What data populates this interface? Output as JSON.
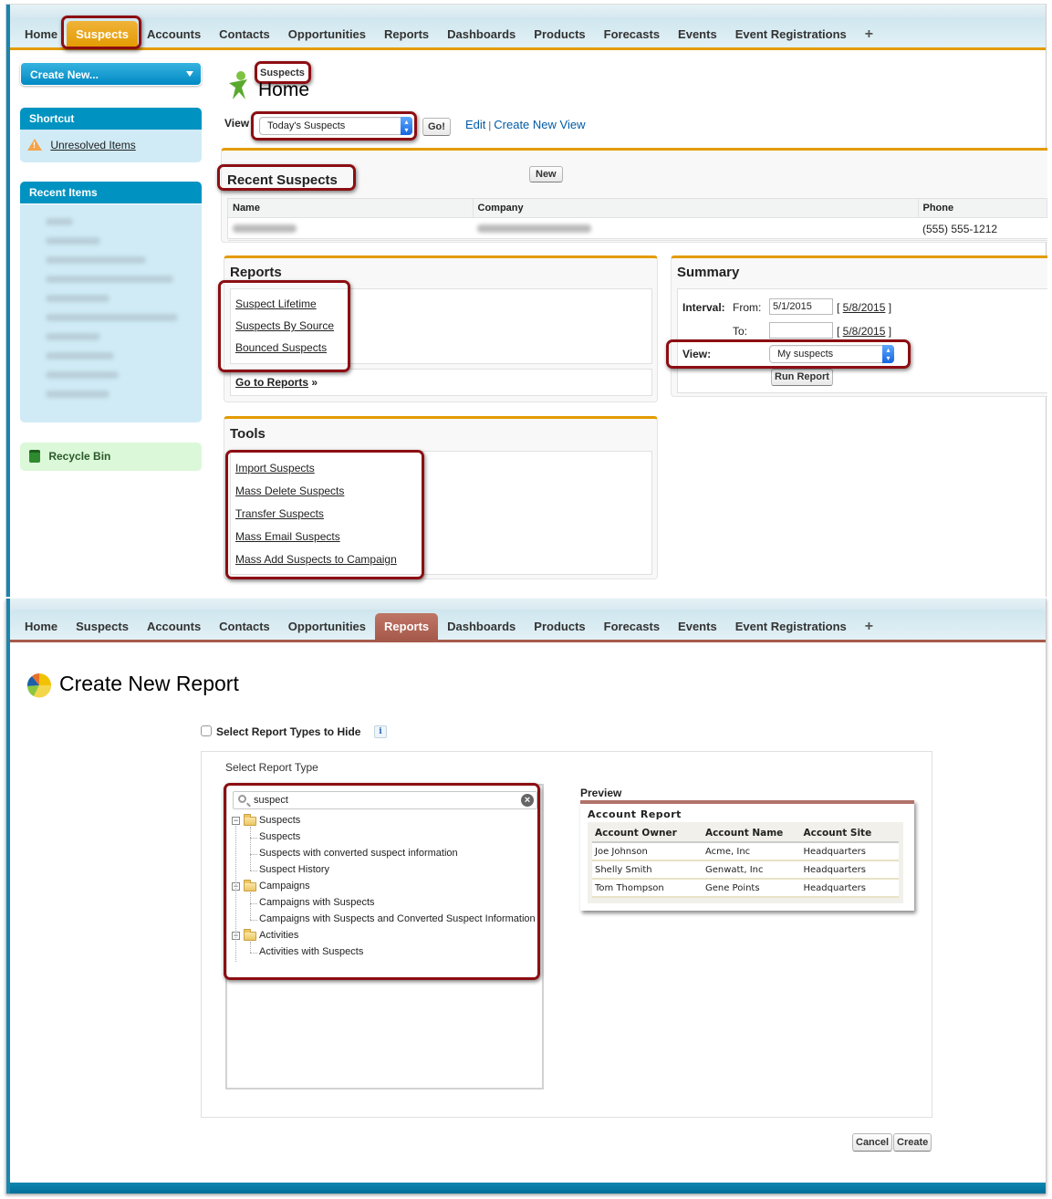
{
  "nav_tabs_top": [
    "Home",
    "Suspects",
    "Accounts",
    "Contacts",
    "Opportunities",
    "Reports",
    "Dashboards",
    "Products",
    "Forecasts",
    "Events",
    "Event Registrations"
  ],
  "nav_tabs_bottom": [
    "Home",
    "Suspects",
    "Accounts",
    "Contacts",
    "Opportunities",
    "Reports",
    "Dashboards",
    "Products",
    "Forecasts",
    "Events",
    "Event Registrations"
  ],
  "nav_plus_icon": "+",
  "top_active_tab": "Suspects",
  "bottom_active_tab": "Reports",
  "colors": {
    "suspects_accent": "#e39b00",
    "reports_accent": "#a65a4b",
    "sidebar_blue": "#0093c1",
    "highlight": "#8c0e13"
  },
  "sidebar": {
    "create_new": "Create New...",
    "shortcut_header": "Shortcut",
    "shortcut_item": "Unresolved Items",
    "recent_header": "Recent Items",
    "recycle_bin": "Recycle Bin"
  },
  "suspects_home": {
    "breadcrumb": "Suspects",
    "title": "Home",
    "view_label": "View",
    "view_selected": "Today's Suspects",
    "go_button": "Go!",
    "edit_link": "Edit",
    "separator": "|",
    "create_view_link": "Create New View",
    "recent": {
      "title": "Recent Suspects",
      "new_button": "New",
      "columns": [
        "Name",
        "Company",
        "Phone"
      ],
      "rows": [
        {
          "name": "",
          "company": "",
          "phone": "(555) 555-1212"
        }
      ]
    },
    "reports": {
      "title": "Reports",
      "links": [
        "Suspect Lifetime",
        "Suspects By Source",
        "Bounced Suspects"
      ],
      "go_to": "Go to Reports",
      "go_to_suffix": "»"
    },
    "summary": {
      "title": "Summary",
      "interval_label": "Interval:",
      "from_label": "From:",
      "from_value": "5/1/2015",
      "from_date_link": "5/8/2015",
      "to_label": "To:",
      "to_value": "",
      "to_date_link": "5/8/2015",
      "view_label": "View:",
      "view_selected": "My suspects",
      "run_button": "Run Report"
    },
    "tools": {
      "title": "Tools",
      "links": [
        "Import Suspects",
        "Mass Delete Suspects",
        "Transfer Suspects",
        "Mass Email Suspects",
        "Mass Add Suspects to Campaign"
      ]
    }
  },
  "create_report": {
    "title": "Create New Report",
    "hide_checkbox_label": "Select Report Types to Hide",
    "hide_checked": false,
    "info_icon": "i",
    "select_type_label": "Select Report Type",
    "search_value": "suspect",
    "tree": [
      {
        "folder": "Suspects",
        "items": [
          "Suspects",
          "Suspects with converted suspect information",
          "Suspect History"
        ]
      },
      {
        "folder": "Campaigns",
        "items": [
          "Campaigns with Suspects",
          "Campaigns with Suspects and Converted Suspect Information"
        ]
      },
      {
        "folder": "Activities",
        "items": [
          "Activities with Suspects"
        ]
      }
    ],
    "preview_label": "Preview",
    "preview": {
      "title": "Account Report",
      "columns": [
        "Account  Owner",
        "Account Name",
        "Account Site"
      ],
      "rows": [
        [
          "Joe Johnson",
          "Acme, Inc",
          "Headquarters"
        ],
        [
          "Shelly Smith",
          "Genwatt, Inc",
          "Headquarters"
        ],
        [
          "Tom Thompson",
          "Gene Points",
          "Headquarters"
        ]
      ]
    },
    "cancel_button": "Cancel",
    "create_button": "Create"
  }
}
